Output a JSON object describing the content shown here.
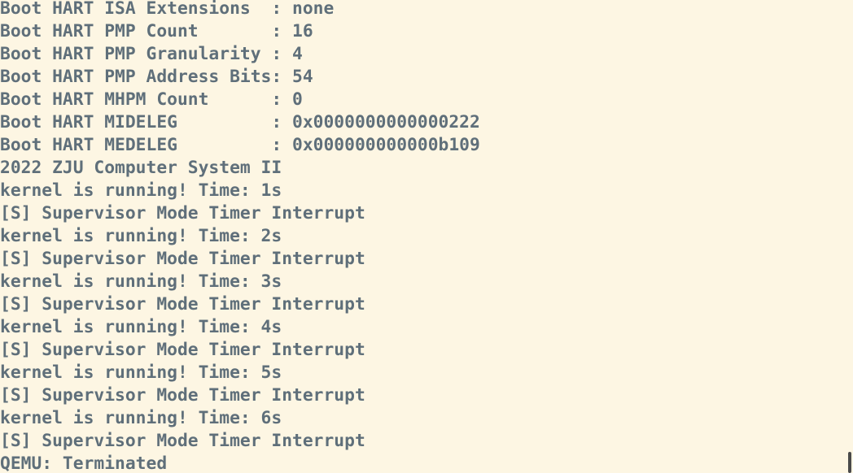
{
  "terminal": {
    "lines": [
      "Boot HART ISA Extensions  : none",
      "Boot HART PMP Count       : 16",
      "Boot HART PMP Granularity : 4",
      "Boot HART PMP Address Bits: 54",
      "Boot HART MHPM Count      : 0",
      "Boot HART MIDELEG         : 0x0000000000000222",
      "Boot HART MEDELEG         : 0x000000000000b109",
      "2022 ZJU Computer System II",
      "kernel is running! Time: 1s",
      "[S] Supervisor Mode Timer Interrupt",
      "kernel is running! Time: 2s",
      "[S] Supervisor Mode Timer Interrupt",
      "kernel is running! Time: 3s",
      "[S] Supervisor Mode Timer Interrupt",
      "kernel is running! Time: 4s",
      "[S] Supervisor Mode Timer Interrupt",
      "kernel is running! Time: 5s",
      "[S] Supervisor Mode Timer Interrupt",
      "kernel is running! Time: 6s",
      "[S] Supervisor Mode Timer Interrupt",
      "QEMU: Terminated"
    ]
  },
  "colors": {
    "background": "#fdf6e3",
    "text": "#5f6f7a",
    "scrollbar_thumb": "#4a4a4a"
  }
}
